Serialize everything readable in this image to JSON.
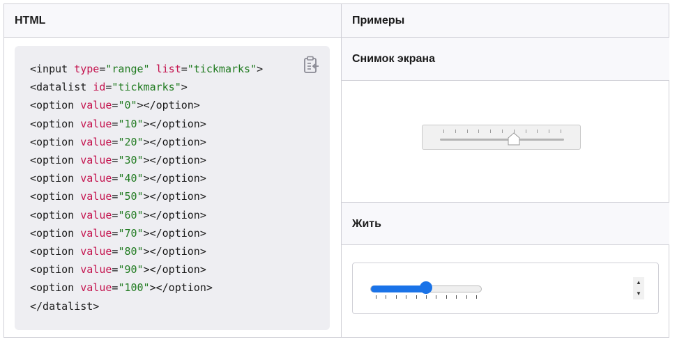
{
  "table": {
    "header_html": "HTML",
    "header_examples": "Примеры"
  },
  "code": {
    "lines": [
      [
        [
          "tg",
          "<input "
        ],
        [
          "at",
          "type"
        ],
        [
          "tg",
          "="
        ],
        [
          "st",
          "\"range\""
        ],
        [
          "tg",
          " "
        ],
        [
          "at",
          "list"
        ],
        [
          "tg",
          "="
        ],
        [
          "st",
          "\"tickmarks\""
        ],
        [
          "tg",
          ">"
        ]
      ],
      [
        [
          "tg",
          "<datalist "
        ],
        [
          "at",
          "id"
        ],
        [
          "tg",
          "="
        ],
        [
          "st",
          "\"tickmarks\""
        ],
        [
          "tg",
          ">"
        ]
      ],
      [
        [
          "tg",
          "<option "
        ],
        [
          "at",
          "value"
        ],
        [
          "tg",
          "="
        ],
        [
          "st",
          "\"0\""
        ],
        [
          "tg",
          "></option>"
        ]
      ],
      [
        [
          "tg",
          "<option "
        ],
        [
          "at",
          "value"
        ],
        [
          "tg",
          "="
        ],
        [
          "st",
          "\"10\""
        ],
        [
          "tg",
          "></option>"
        ]
      ],
      [
        [
          "tg",
          "<option "
        ],
        [
          "at",
          "value"
        ],
        [
          "tg",
          "="
        ],
        [
          "st",
          "\"20\""
        ],
        [
          "tg",
          "></option>"
        ]
      ],
      [
        [
          "tg",
          "<option "
        ],
        [
          "at",
          "value"
        ],
        [
          "tg",
          "="
        ],
        [
          "st",
          "\"30\""
        ],
        [
          "tg",
          "></option>"
        ]
      ],
      [
        [
          "tg",
          "<option "
        ],
        [
          "at",
          "value"
        ],
        [
          "tg",
          "="
        ],
        [
          "st",
          "\"40\""
        ],
        [
          "tg",
          "></option>"
        ]
      ],
      [
        [
          "tg",
          "<option "
        ],
        [
          "at",
          "value"
        ],
        [
          "tg",
          "="
        ],
        [
          "st",
          "\"50\""
        ],
        [
          "tg",
          "></option>"
        ]
      ],
      [
        [
          "tg",
          "<option "
        ],
        [
          "at",
          "value"
        ],
        [
          "tg",
          "="
        ],
        [
          "st",
          "\"60\""
        ],
        [
          "tg",
          "></option>"
        ]
      ],
      [
        [
          "tg",
          "<option "
        ],
        [
          "at",
          "value"
        ],
        [
          "tg",
          "="
        ],
        [
          "st",
          "\"70\""
        ],
        [
          "tg",
          "></option>"
        ]
      ],
      [
        [
          "tg",
          "<option "
        ],
        [
          "at",
          "value"
        ],
        [
          "tg",
          "="
        ],
        [
          "st",
          "\"80\""
        ],
        [
          "tg",
          "></option>"
        ]
      ],
      [
        [
          "tg",
          "<option "
        ],
        [
          "at",
          "value"
        ],
        [
          "tg",
          "="
        ],
        [
          "st",
          "\"90\""
        ],
        [
          "tg",
          "></option>"
        ]
      ],
      [
        [
          "tg",
          "<option "
        ],
        [
          "at",
          "value"
        ],
        [
          "tg",
          "="
        ],
        [
          "st",
          "\"100\""
        ],
        [
          "tg",
          "></option>"
        ]
      ],
      [
        [
          "tg",
          "</datalist>"
        ]
      ]
    ],
    "copy_icon": "clipboard-copy-icon"
  },
  "examples": {
    "screenshot_title": "Снимок экрана",
    "live_title": "Жить",
    "screenshot_slider": {
      "value": 60,
      "min": 0,
      "max": 100,
      "ticks": [
        0,
        10,
        20,
        30,
        40,
        50,
        60,
        70,
        80,
        90,
        100
      ]
    },
    "live_slider": {
      "value": 50,
      "min": 0,
      "max": 100,
      "ticks": [
        0,
        10,
        20,
        30,
        40,
        50,
        60,
        70,
        80,
        90,
        100
      ]
    },
    "colors": {
      "accent": "#1a73e8",
      "attr": "#c4134e",
      "string": "#1f7a1f",
      "code_bg": "#eeeef2"
    }
  }
}
